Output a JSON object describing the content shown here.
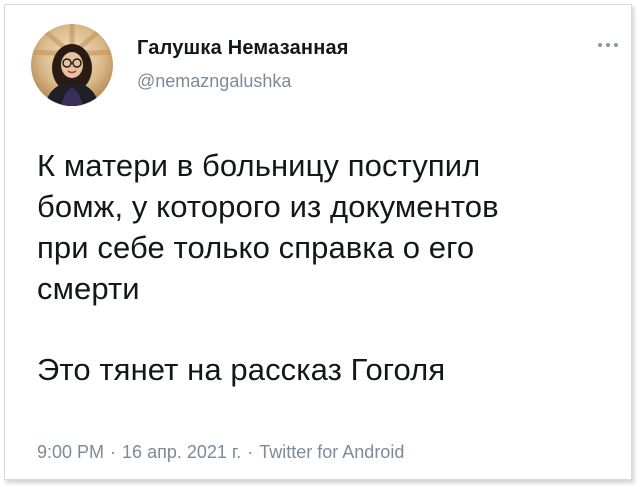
{
  "author": {
    "display_name": "Галушка Немазанная",
    "handle": "@nemazngalushka"
  },
  "tweet": {
    "lines": [
      "К матери в больницу поступил",
      "бомж, у которого из документов",
      "при себе только справка о его",
      "смерти"
    ],
    "closing_line": "Это тянет на рассказ Гоголя"
  },
  "meta": {
    "time": "9:00 PM",
    "date": "16 апр. 2021 г.",
    "separator": "·",
    "source": "Twitter for Android"
  },
  "icons": {
    "more": "more-horizontal-icon",
    "avatar": "profile-avatar"
  },
  "colors": {
    "text": "#14171a",
    "secondary": "#7c8b98",
    "background": "#ffffff"
  }
}
